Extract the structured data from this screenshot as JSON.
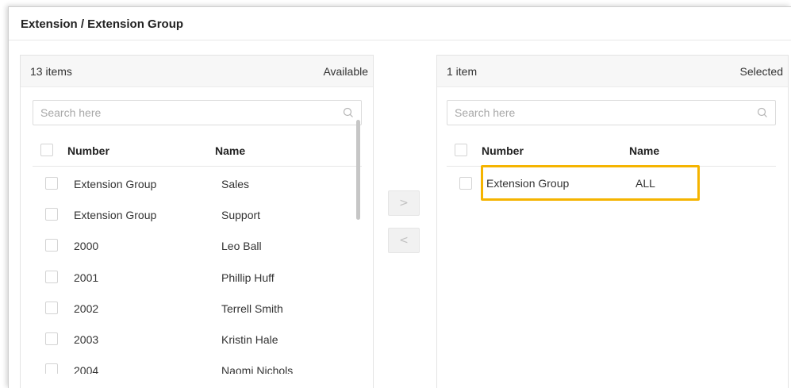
{
  "header": {
    "title": "Extension / Extension Group"
  },
  "available": {
    "count": "13 items",
    "label": "Available",
    "search_placeholder": "Search here",
    "columns": {
      "number": "Number",
      "name": "Name"
    },
    "rows": [
      {
        "number": "Extension Group",
        "name": "Sales"
      },
      {
        "number": "Extension Group",
        "name": "Support"
      },
      {
        "number": "2000",
        "name": "Leo Ball"
      },
      {
        "number": "2001",
        "name": "Phillip Huff"
      },
      {
        "number": "2002",
        "name": "Terrell Smith"
      },
      {
        "number": "2003",
        "name": "Kristin Hale"
      },
      {
        "number": "2004",
        "name": "Naomi Nichols"
      }
    ]
  },
  "selected": {
    "count": "1 item",
    "label": "Selected",
    "search_placeholder": "Search here",
    "columns": {
      "number": "Number",
      "name": "Name"
    },
    "rows": [
      {
        "number": "Extension Group",
        "name": "ALL"
      }
    ]
  },
  "transfer": {
    "move_right": ">",
    "move_left": "<"
  },
  "colors": {
    "highlight": "#f5b400",
    "panel_header": "#f7f7f7"
  }
}
